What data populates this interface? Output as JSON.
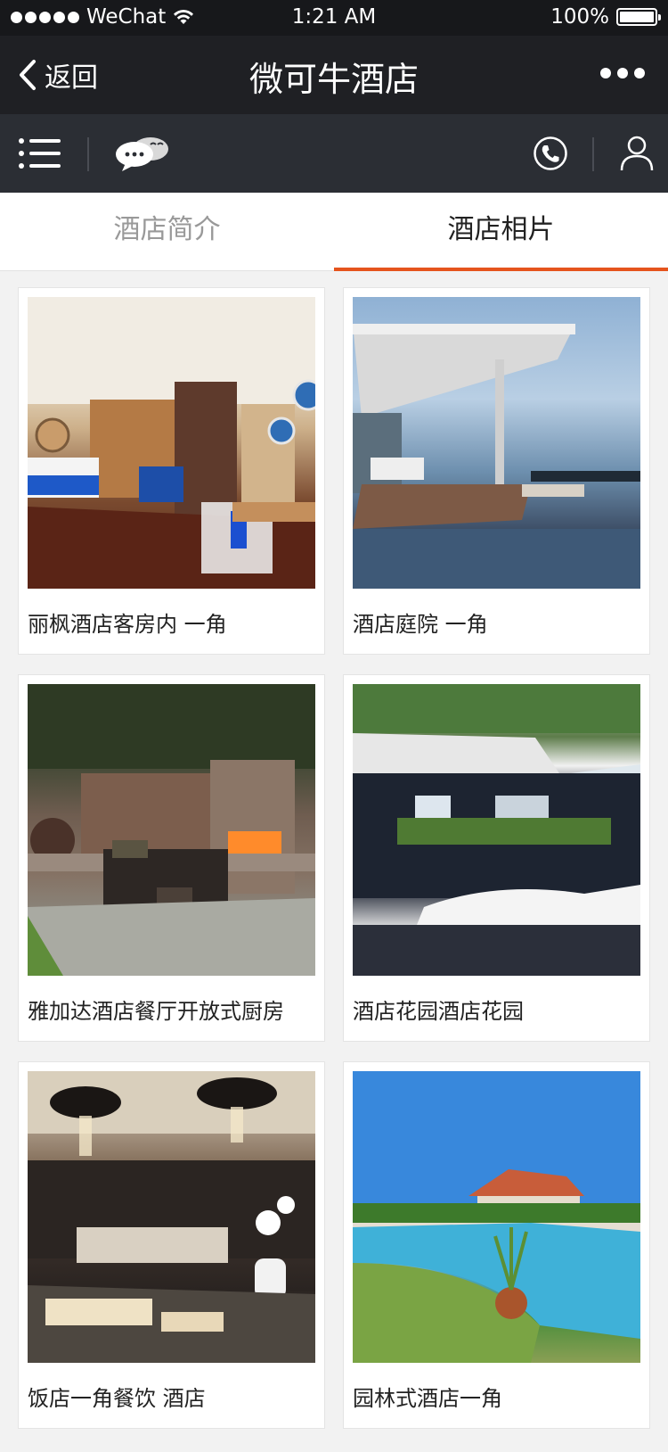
{
  "status_bar": {
    "carrier": "WeChat",
    "time": "1:21 AM",
    "battery": "100%",
    "battery_level": 1.0
  },
  "nav": {
    "back_label": "返回",
    "title": "微可牛酒店"
  },
  "toolbar": {
    "icons": [
      "menu-icon",
      "chat-icon",
      "phone-icon",
      "user-icon"
    ]
  },
  "tabs": [
    {
      "label": "酒店简介",
      "active": false
    },
    {
      "label": "酒店相片",
      "active": true
    }
  ],
  "colors": {
    "accent": "#e5541d",
    "nav_bg": "#1f2024",
    "toolbar_bg": "#2b2e34"
  },
  "photos": [
    {
      "caption": "丽枫酒店客房内 一角"
    },
    {
      "caption": "酒店庭院 一角"
    },
    {
      "caption": "雅加达酒店餐厅开放式厨房"
    },
    {
      "caption": "酒店花园酒店花园"
    },
    {
      "caption": "饭店一角餐饮 酒店"
    },
    {
      "caption": "园林式酒店一角"
    }
  ]
}
